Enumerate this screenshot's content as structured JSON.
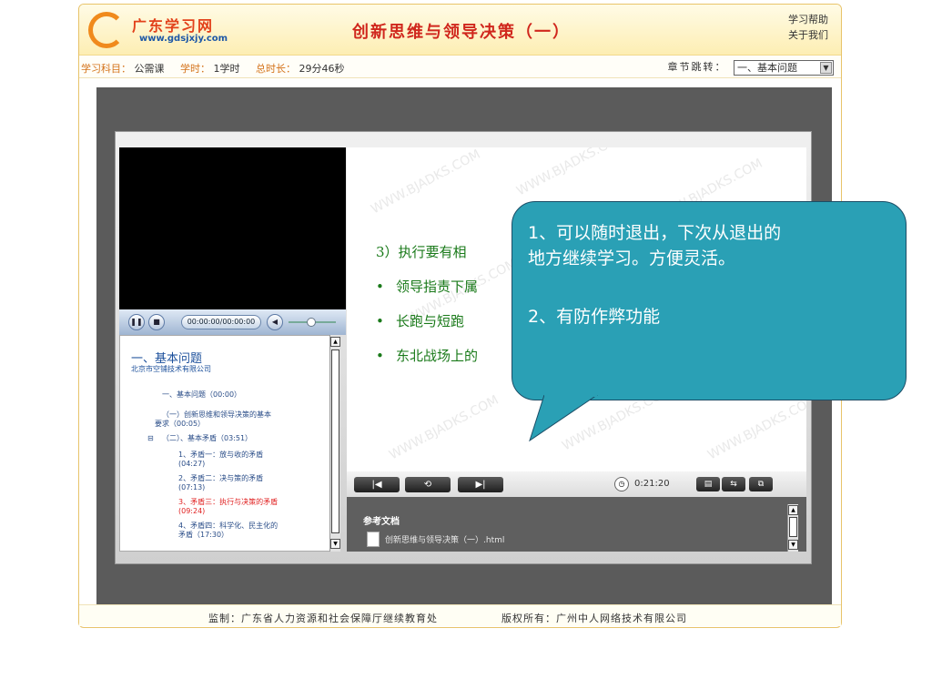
{
  "header": {
    "logo_name": "广东学习网",
    "logo_url": "www.gdsjxjy.com",
    "title": "创新思维与领导决策（一）",
    "links": [
      "学习帮助",
      "关于我们"
    ]
  },
  "info": {
    "subject_key": "学习科目：",
    "subject_val": "公需课",
    "hours_key": "学时：",
    "hours_val": "1学时",
    "duration_key": "总时长：",
    "duration_val": "29分46秒",
    "chapter_label": "章节跳转：",
    "chapter_value": "一、基本问题"
  },
  "player": {
    "time_display": "00:00:00/00:00:00"
  },
  "outline": {
    "title": "一、基本问题",
    "subtitle": "北京市空铺技术有限公司",
    "items": [
      "一、基本问题（00:00）",
      "（一）创新思维和领导决策的基本",
      "要求（00:05）",
      "（二）、基本矛盾（03:51）",
      "1、矛盾一：放与收的矛盾",
      "(04:27)",
      "2、矛盾二：决与策的矛盾",
      "(07:13)",
      "3、矛盾三：执行与决策的矛盾",
      "(09:24)",
      "4、矛盾四：科学化、民主化的",
      "矛盾（17:30）"
    ]
  },
  "slide": {
    "heading": "3）执行要有相",
    "bullets": [
      "领导指责下属",
      "长跑与短跑",
      "东北战场上的"
    ],
    "watermark": "WWW.BJADKS.COM"
  },
  "callout": {
    "line1": "1、可以随时退出，下次从退出的",
    "line2": "地方继续学习。方便灵活。",
    "line3": "2、有防作弊功能"
  },
  "controls": {
    "elapsed": "0:21:20"
  },
  "refs": {
    "title": "参考文档",
    "doc": "创新思维与领导决策（一）.html"
  },
  "footer": {
    "supervisor": "监制：广东省人力资源和社会保障厅继续教育处",
    "copyright": "版权所有：广州中人网络技术有限公司"
  }
}
